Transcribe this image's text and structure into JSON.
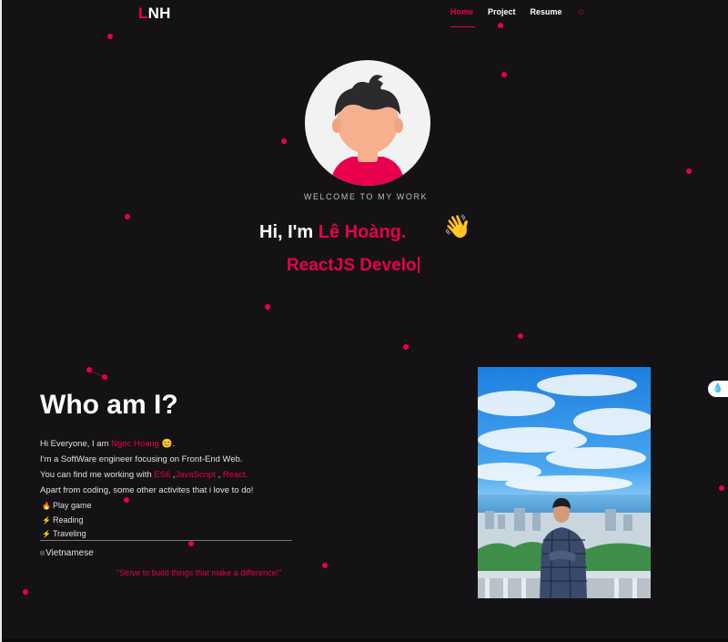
{
  "header": {
    "logo_first": "L",
    "logo_rest": "NH",
    "nav": [
      "Home",
      "Project",
      "Resume"
    ],
    "active_tab": "Home",
    "theme_icon": "sun-icon"
  },
  "hero": {
    "welcome": "WELCOME TO MY WORK",
    "greeting": "Hi, I'm ",
    "name": "Lê Hoàng.",
    "wave": "👋",
    "typed_text": "ReactJS Develo"
  },
  "about": {
    "title": "Who am I?",
    "intro_prefix": "Hi Everyone, I am ",
    "intro_name": "Ngoc Hoang",
    "intro_emoji": "😊",
    "intro_suffix": ".",
    "line2": "I'm a SoftWare engineer focusing on Front-End Web.",
    "line3_prefix": "You can find me working with ",
    "skills": [
      "ES6",
      "JavaScript",
      "React"
    ],
    "line4": "Apart from coding, some other activites that i love to do!",
    "activities": [
      {
        "label": "Play game",
        "icon": "flame-icon"
      },
      {
        "label": "Reading",
        "icon": "lightning-icon"
      },
      {
        "label": "Traveling",
        "icon": "lightning-icon"
      }
    ],
    "language": "Vietnamese",
    "quote": "\"Strive to build things that make a difference!\""
  },
  "colors": {
    "background": "#141214",
    "accent": "#e8004d",
    "text": "#ffffff"
  }
}
